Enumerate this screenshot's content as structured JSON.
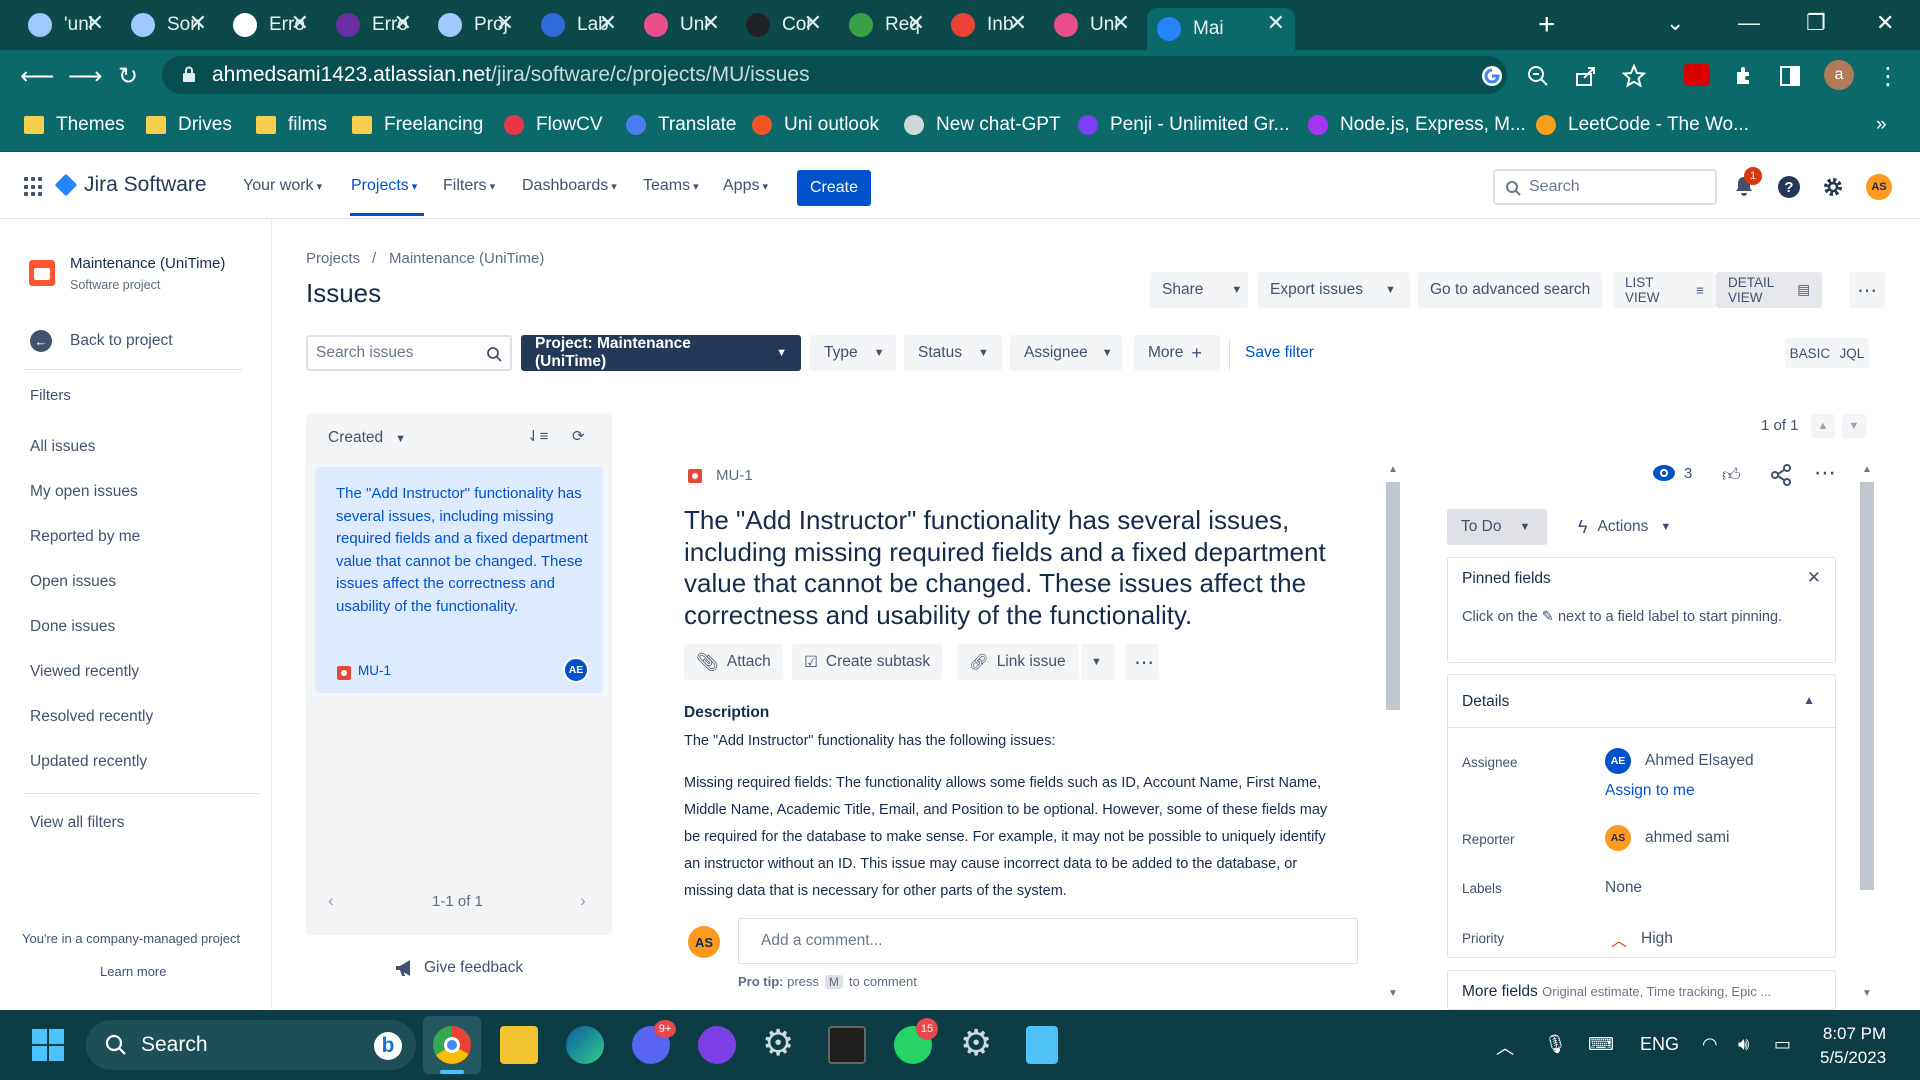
{
  "browser": {
    "tabs": [
      {
        "title": "'uni",
        "icon": "sound-icon",
        "color": "#9ec8ff"
      },
      {
        "title": "Son",
        "icon": "sound-icon",
        "color": "#9ec8ff"
      },
      {
        "title": "Erro",
        "icon": "google-icon",
        "color": "#ffffff"
      },
      {
        "title": "Erro",
        "icon": "purple-circle-icon",
        "color": "#6b2fa3"
      },
      {
        "title": "Proj",
        "icon": "sound-icon",
        "color": "#9ec8ff"
      },
      {
        "title": "Lab",
        "icon": "page-icon",
        "color": "#2d6bd6"
      },
      {
        "title": "Uni",
        "icon": "uni-icon",
        "color": "#e84e89"
      },
      {
        "title": "Cor",
        "icon": "github-icon",
        "color": "#1f2328"
      },
      {
        "title": "Req",
        "icon": "leaf-icon",
        "color": "#3aa048"
      },
      {
        "title": "Inb",
        "icon": "gmail-icon",
        "color": "#ea4335"
      },
      {
        "title": "Uni",
        "icon": "uni-icon",
        "color": "#e84e89"
      },
      {
        "title": "Mai",
        "icon": "jira-icon",
        "color": "#2684ff"
      }
    ],
    "url_host": "ahmedsami1423.atlassian.net",
    "url_path": "/jira/software/c/projects/MU/issues",
    "profile_initial": "a",
    "bookmarks": [
      {
        "label": "Themes",
        "icon": "folder"
      },
      {
        "label": "Drives",
        "icon": "folder"
      },
      {
        "label": "films",
        "icon": "folder"
      },
      {
        "label": "Freelancing",
        "icon": "folder"
      },
      {
        "label": "FlowCV",
        "icon": "flowcv"
      },
      {
        "label": "Translate",
        "icon": "translate"
      },
      {
        "label": "Uni outlook",
        "icon": "microsoft"
      },
      {
        "label": "New chat-GPT",
        "icon": "openai"
      },
      {
        "label": "Penji - Unlimited Gr...",
        "icon": "penji"
      },
      {
        "label": "Node.js, Express, M...",
        "icon": "udemy"
      },
      {
        "label": "LeetCode - The Wo...",
        "icon": "leetcode"
      }
    ],
    "more_bookmarks": "»"
  },
  "jira_nav": {
    "product": "Jira Software",
    "menu": [
      "Your work",
      "Projects",
      "Filters",
      "Dashboards",
      "Teams",
      "Apps"
    ],
    "create": "Create",
    "search_placeholder": "Search",
    "notification_count": "1",
    "user_initials": "AS"
  },
  "sidebar": {
    "project_name": "Maintenance (UniTime)",
    "project_type": "Software project",
    "back": "Back to project",
    "filters_heading": "Filters",
    "filters": [
      "All issues",
      "My open issues",
      "Reported by me",
      "Open issues",
      "Done issues",
      "Viewed recently",
      "Resolved recently",
      "Updated recently"
    ],
    "view_all": "View all filters",
    "company_note": "You're in a company-managed project",
    "learn_more": "Learn more"
  },
  "main": {
    "breadcrumb": [
      "Projects",
      "Maintenance (UniTime)"
    ],
    "breadcrumb_sep": "/",
    "title": "Issues",
    "share": "Share",
    "export": "Export issues",
    "advanced": "Go to advanced search",
    "list_view": "LIST VIEW",
    "detail_view": "DETAIL VIEW",
    "search_placeholder": "Search issues",
    "project_filter": "Project: Maintenance (UniTime)",
    "type": "Type",
    "status": "Status",
    "assignee": "Assignee",
    "more": "More",
    "save_filter": "Save filter",
    "basic": "BASIC",
    "jql": "JQL"
  },
  "list": {
    "sort_label": "Created",
    "card_text": "The \"Add Instructor\" functionality has several issues, including missing required fields and a fixed department value that cannot be changed. These issues affect the correctness and usability of the functionality.",
    "card_key": "MU-1",
    "card_assignee": "AE",
    "pager": "1-1 of 1",
    "feedback": "Give feedback"
  },
  "detail": {
    "count": "1 of 1",
    "key": "MU-1",
    "title": "The \"Add Instructor\" functionality has several issues, including missing required fields and a fixed department value that cannot be changed. These issues affect the correctness and usability of the functionality.",
    "attach": "Attach",
    "subtask": "Create subtask",
    "link": "Link issue",
    "description_heading": "Description",
    "description_intro": "The \"Add Instructor\" functionality has the following issues:",
    "description_body": "Missing required fields: The functionality allows some fields such as ID, Account Name, First Name, Middle Name, Academic Title, Email, and Position to be optional. However, some of these fields may be required for the database to make sense. For example, it may not be possible to uniquely identify an instructor without an ID. This issue may cause incorrect data to be added to the database, or missing data that is necessary for other parts of the system.",
    "comment_avatar": "AS",
    "comment_placeholder": "Add a comment...",
    "protip_label": "Pro tip:",
    "protip_press": "press",
    "protip_key": "M",
    "protip_suffix": "to comment",
    "watchers": "3",
    "status": "To Do",
    "actions": "Actions",
    "pinned_heading": "Pinned fields",
    "pinned_text_a": "Click on the",
    "pinned_text_b": "next to a field label to start pinning.",
    "details_heading": "Details",
    "assignee_label": "Assignee",
    "assignee_initials": "AE",
    "assignee_name": "Ahmed Elsayed",
    "assign_me": "Assign to me",
    "reporter_label": "Reporter",
    "reporter_initials": "AS",
    "reporter_name": "ahmed sami",
    "labels_label": "Labels",
    "labels_value": "None",
    "priority_label": "Priority",
    "priority_value": "High",
    "more_fields": "More fields",
    "more_fields_hint": "Original estimate, Time tracking, Epic ..."
  },
  "taskbar": {
    "search": "Search",
    "discord_badge": "9+",
    "whatsapp_badge": "15",
    "lang": "ENG",
    "time": "8:07 PM",
    "date": "5/5/2023"
  },
  "colors": {
    "chrome_dark": "#0c4a4a",
    "chrome": "#0b6a69",
    "jira_blue": "#0052cc",
    "taskbar": "#0c3d45"
  }
}
